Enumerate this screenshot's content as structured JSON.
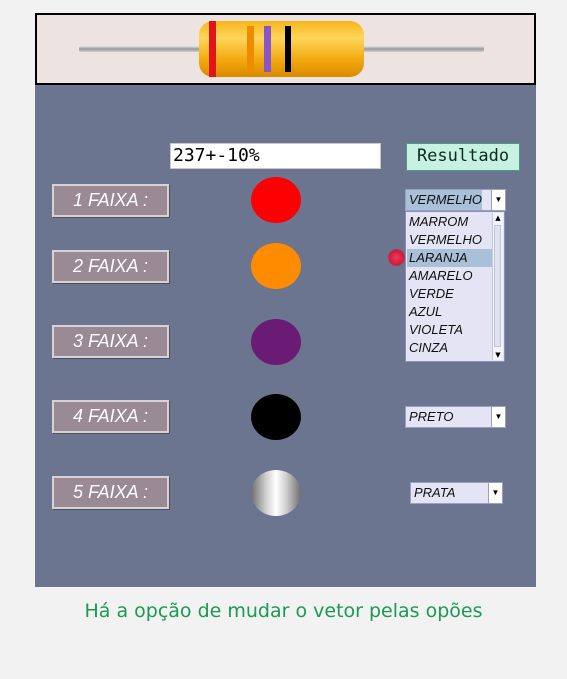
{
  "result": {
    "value": "237+-10%",
    "button_label": "Resultado"
  },
  "bands": [
    {
      "label": "1 FAIXA :",
      "color": "#ff0000",
      "selected": "VERMELHO"
    },
    {
      "label": "2 FAIXA :",
      "color": "#ff8c00"
    },
    {
      "label": "3 FAIXA :",
      "color": "#6a1b75"
    },
    {
      "label": "4 FAIXA :",
      "color": "#000000",
      "selected": "PRETO"
    },
    {
      "label": "5 FAIXA :",
      "color": "silver-gradient",
      "selected": "PRATA"
    }
  ],
  "dropdown": {
    "options": [
      "MARROM",
      "VERMELHO",
      "LARANJA",
      "AMARELO",
      "VERDE",
      "AZUL",
      "VIOLETA",
      "CINZA"
    ],
    "highlighted": "LARANJA"
  },
  "resistor": {
    "band_colors": [
      "#e0151b",
      "#f08a00",
      "#8a55c8",
      "#000000"
    ]
  },
  "caption": "Há a opção de mudar o vetor pelas opões"
}
